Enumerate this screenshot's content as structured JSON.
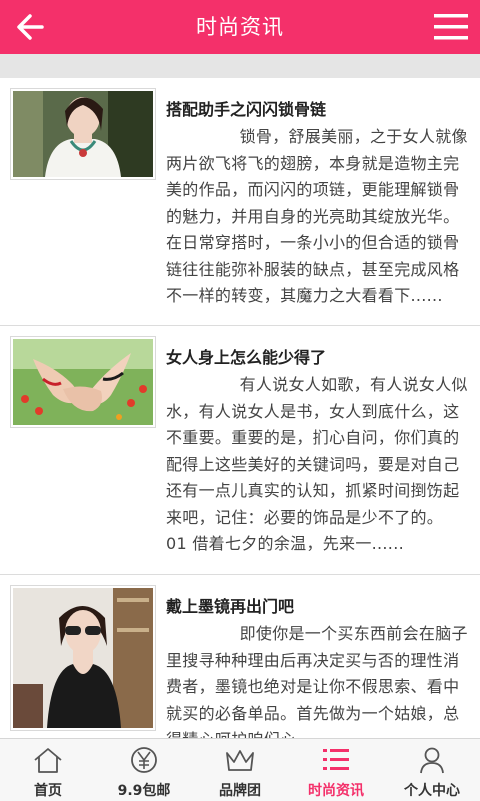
{
  "header": {
    "title": "时尚资讯",
    "accent": "#f4306a"
  },
  "articles": [
    {
      "title": "搭配助手之闪闪锁骨链",
      "body": "锁骨，舒展美丽，之于女人就像两片欲飞将飞的翅膀，本身就是造物主完美的作品，而闪闪的项链，更能理解锁骨的魅力，并用自身的光亮助其绽放光华。在日常穿搭时，一条小小的但合适的锁骨链往往能弥补服装的缺点，甚至完成风格不一样的转变，其魔力之大看看下......"
    },
    {
      "title": "女人身上怎么能少得了",
      "body": "有人说女人如歌，有人说女人似水，有人说女人是书，女人到底什么，这不重要。重要的是，扪心自问，你们真的配得上这些美好的关键词吗，要是对自己还有一点儿真实的认知，抓紧时间捯饬起来吧，记住：必要的饰品是少不了的。　　01 借着七夕的余温，先来一......"
    },
    {
      "title": "戴上墨镜再出门吧",
      "body": "即使你是一个买东西前会在脑子里搜寻种种理由后再决定买与否的理性消费者，墨镜也绝对是让你不假思索、看中就买的必备单品。首先做为一个姑娘，总得精心呵护咱们心"
    }
  ],
  "nav": [
    {
      "label": "首页",
      "icon": "home-icon"
    },
    {
      "label": "9.9包邮",
      "icon": "yen-icon"
    },
    {
      "label": "品牌团",
      "icon": "crown-icon"
    },
    {
      "label": "时尚资讯",
      "icon": "list-icon",
      "active": true
    },
    {
      "label": "个人中心",
      "icon": "person-icon"
    }
  ]
}
